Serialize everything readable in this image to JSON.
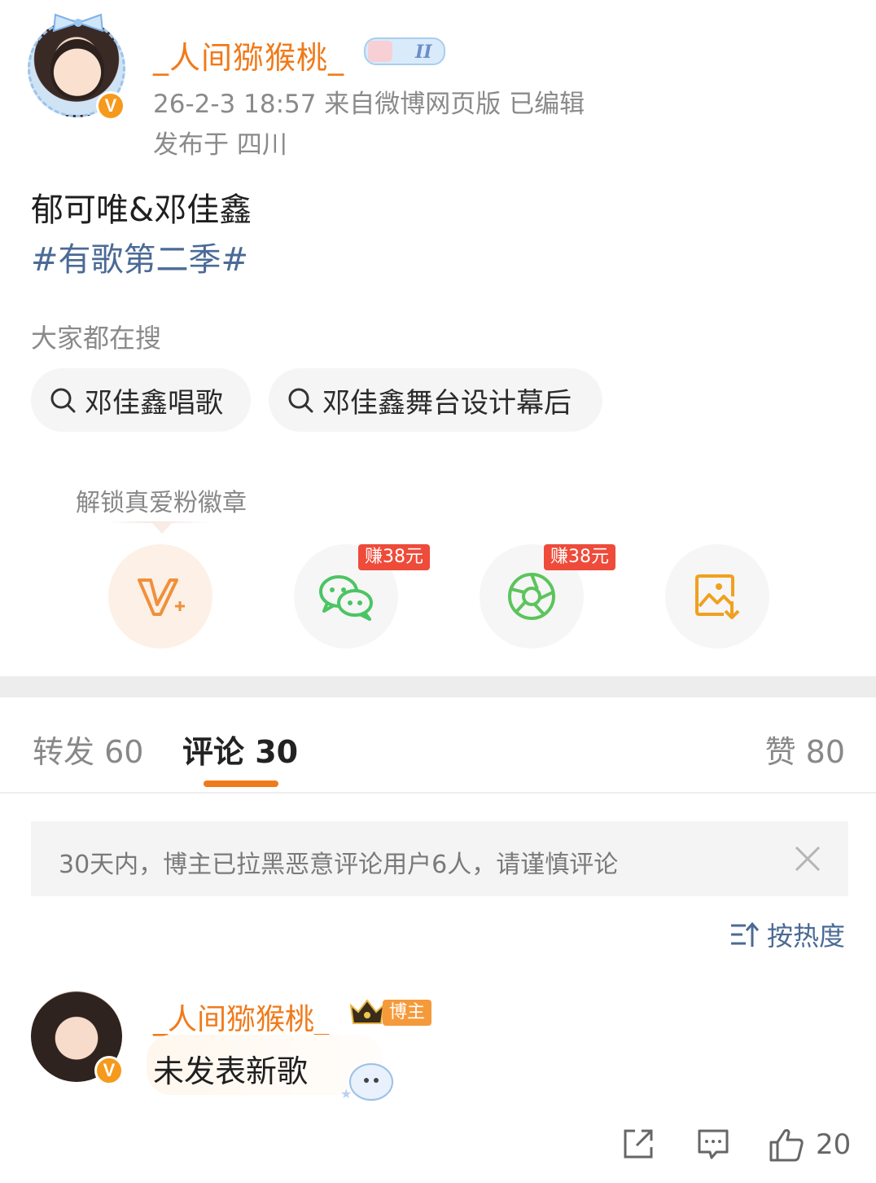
{
  "post": {
    "username": "_人间猕猴桃_",
    "meta_time_source": "26-2-3 18:57  来自微博网页版  已编辑",
    "location": "发布于 四川",
    "text": "郁可唯&邓佳鑫",
    "hashtag": "#有歌第二季#"
  },
  "search": {
    "title": "大家都在搜",
    "chips": [
      "邓佳鑫唱歌",
      "邓佳鑫舞台设计幕后"
    ]
  },
  "share": {
    "unlock_label": "解锁真爱粉徽章",
    "earn_badges": [
      "赚38元",
      "赚38元"
    ],
    "icons": [
      "v-plus-icon",
      "wechat-icon",
      "moments-icon",
      "save-image-icon"
    ],
    "colors": {
      "v_plus": "#f0903a",
      "wechat": "#4cc464",
      "moments": "#5cc45c",
      "save_image": "#f0a020"
    }
  },
  "tabs": {
    "repost": "转发 60",
    "comment": "评论 30",
    "like": "赞 80"
  },
  "notice": {
    "text": "30天内，博主已拉黑恶意评论用户6人，请谨慎评论"
  },
  "sort": {
    "label": "按热度"
  },
  "comment": {
    "username": "_人间猕猴桃_",
    "host_badge": "博主",
    "text": "未发表新歌",
    "like_count": "20"
  },
  "colors": {
    "accent": "#f07a1a",
    "link": "#4b6a96",
    "verified": "#f59a1c",
    "earn_badge": "#ee4b3a"
  }
}
